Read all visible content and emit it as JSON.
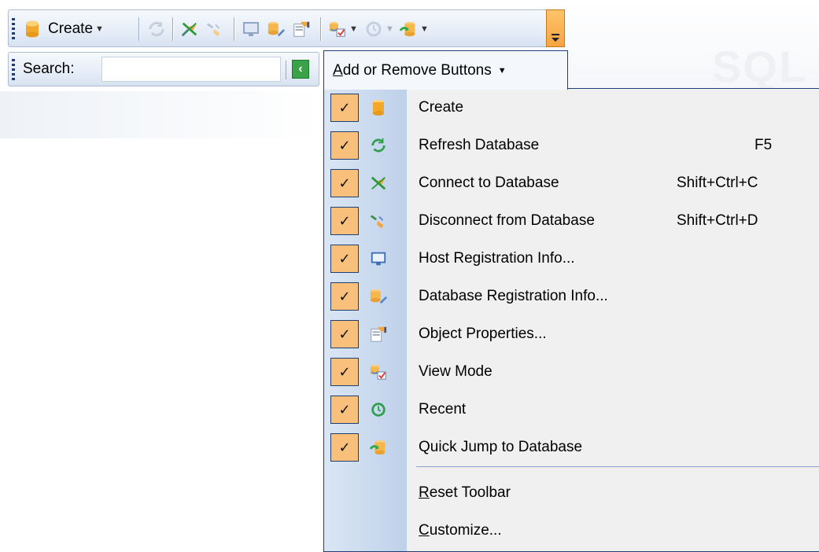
{
  "toolbar": {
    "create_label": "Create",
    "icons": [
      "database-icon",
      "refresh-icon",
      "connect-icon",
      "disconnect-icon",
      "host-icon",
      "database-edit-icon",
      "object-properties-icon",
      "view-mode-icon",
      "recent-icon",
      "quick-jump-icon"
    ]
  },
  "search": {
    "label": "Search:",
    "value": "",
    "placeholder": ""
  },
  "add_remove": {
    "label_prefix": "A",
    "label_rest": "dd or Remove Buttons"
  },
  "menu": {
    "items": [
      {
        "label": "Create",
        "shortcut": "",
        "checked": true,
        "icon": "database-icon"
      },
      {
        "label": "Refresh Database",
        "shortcut": "F5",
        "checked": true,
        "icon": "refresh-icon"
      },
      {
        "label": "Connect to Database",
        "shortcut": "Shift+Ctrl+C",
        "checked": true,
        "icon": "connect-icon"
      },
      {
        "label": "Disconnect from Database",
        "shortcut": "Shift+Ctrl+D",
        "checked": true,
        "icon": "disconnect-icon"
      },
      {
        "label": "Host Registration Info...",
        "shortcut": "",
        "checked": true,
        "icon": "host-icon"
      },
      {
        "label": "Database Registration Info...",
        "shortcut": "",
        "checked": true,
        "icon": "database-edit-icon"
      },
      {
        "label": "Object Properties...",
        "shortcut": "",
        "checked": true,
        "icon": "object-properties-icon"
      },
      {
        "label": "View Mode",
        "shortcut": "",
        "checked": true,
        "icon": "view-mode-icon"
      },
      {
        "label": "Recent",
        "shortcut": "",
        "checked": true,
        "icon": "recent-icon"
      },
      {
        "label": "Quick Jump to Database",
        "shortcut": "",
        "checked": true,
        "icon": "quick-jump-icon"
      }
    ],
    "reset": {
      "mnemonic": "R",
      "rest": "eset Toolbar"
    },
    "customize": {
      "mnemonic": "C",
      "rest": "ustomize..."
    },
    "check_glyph": "✓"
  },
  "colors": {
    "toolbar_top": "#f6f9fd",
    "toolbar_bottom": "#d7e2f1",
    "menu_bg": "#f0f0f0",
    "check_bg": "#f8c07a",
    "border_navy": "#1e3e76",
    "gutter": "#bed1ea"
  }
}
